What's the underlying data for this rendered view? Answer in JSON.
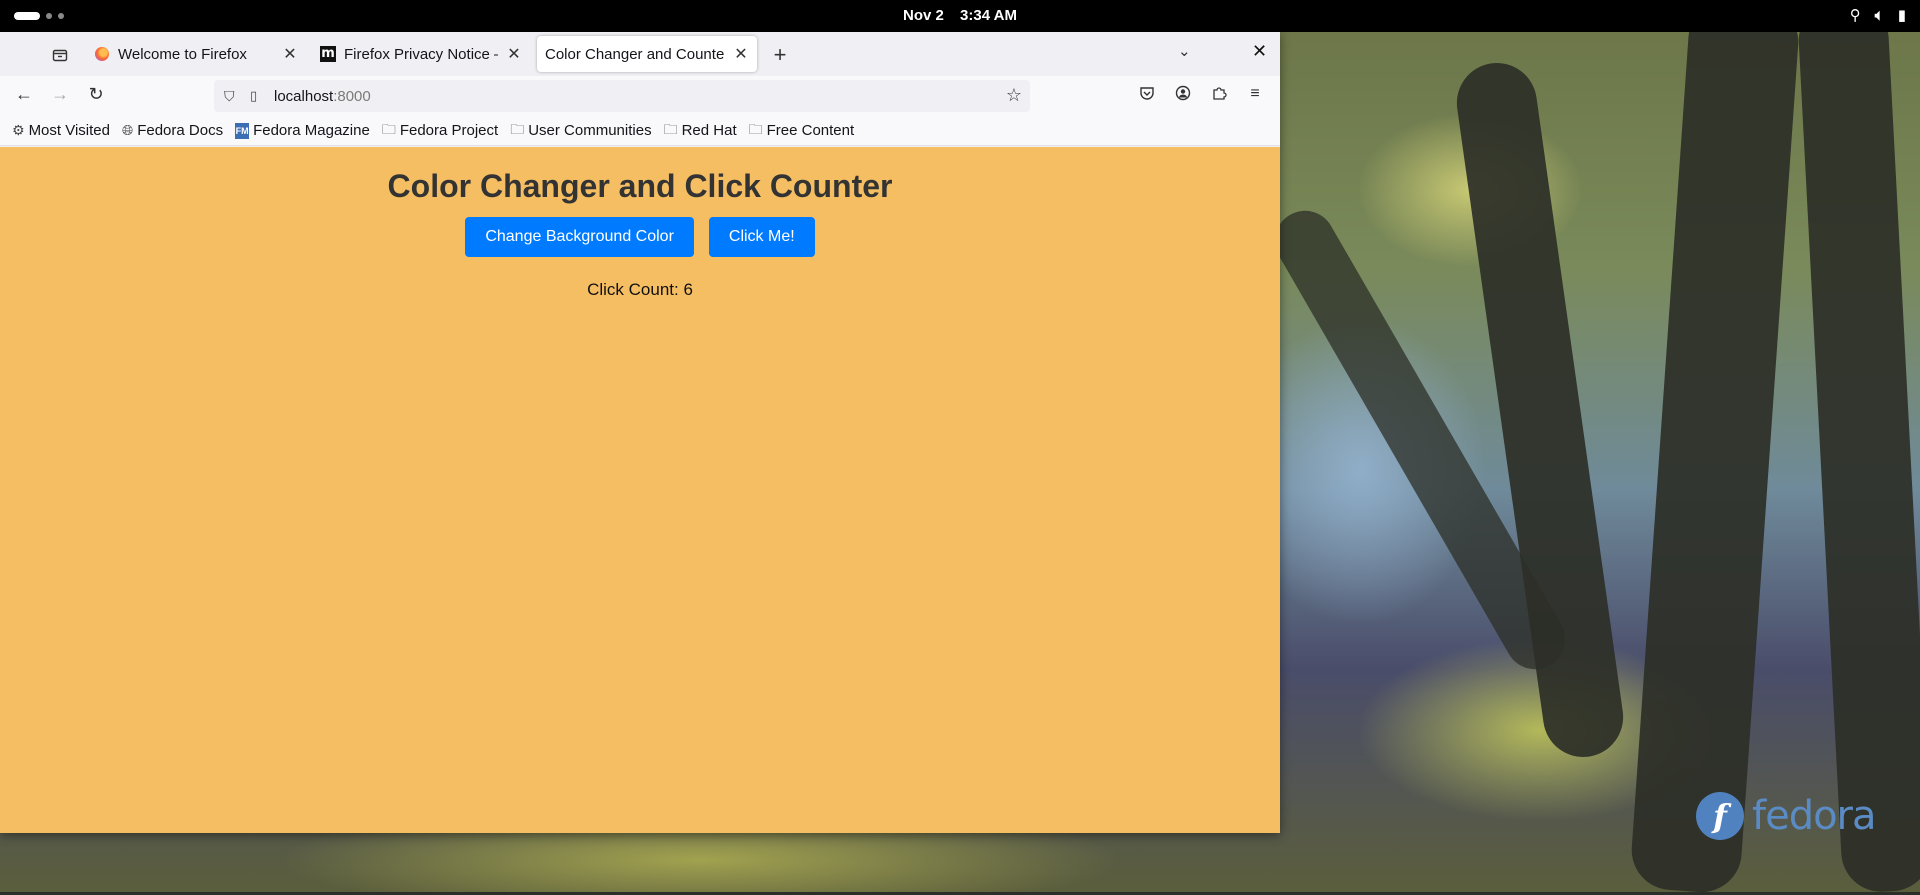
{
  "system_bar": {
    "date": "Nov 2",
    "time": "3:34 AM"
  },
  "browser": {
    "tabs": [
      {
        "title": "Welcome to Firefox",
        "icon": "firefox-icon",
        "selected": false
      },
      {
        "title": "Firefox Privacy Notice — Mozilla",
        "icon": "mozilla-m-icon",
        "selected": false
      },
      {
        "title": "Color Changer and Counter",
        "icon": "none",
        "selected": true
      }
    ],
    "url_host": "localhost",
    "url_port": ":8000",
    "bookmarks": [
      {
        "label": "Most Visited",
        "icon": "gear-icon"
      },
      {
        "label": "Fedora Docs",
        "icon": "globe-icon"
      },
      {
        "label": "Fedora Magazine",
        "icon": "fedora-magazine-icon"
      },
      {
        "label": "Fedora Project",
        "icon": "folder-icon"
      },
      {
        "label": "User Communities",
        "icon": "folder-icon"
      },
      {
        "label": "Red Hat",
        "icon": "folder-icon"
      },
      {
        "label": "Free Content",
        "icon": "folder-icon"
      }
    ]
  },
  "page": {
    "heading": "Color Changer and Click Counter",
    "change_bg_label": "Change Background Color",
    "click_me_label": "Click Me!",
    "click_count_text": "Click Count: 6",
    "background_color": "#f6be63",
    "button_color": "#007bff"
  },
  "desktop": {
    "logo_text": "fedora"
  }
}
